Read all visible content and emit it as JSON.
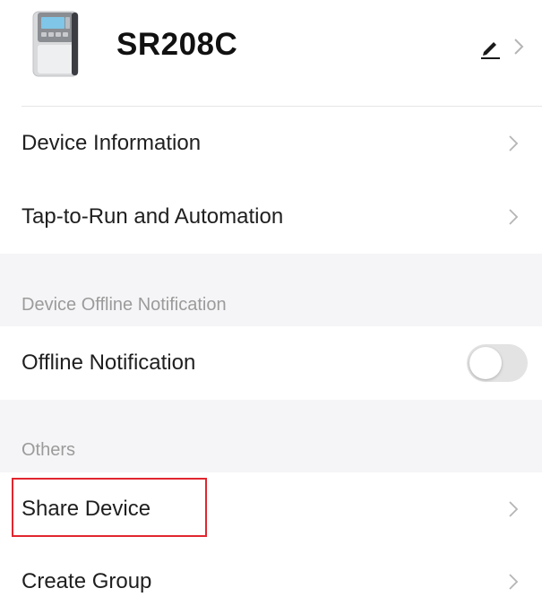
{
  "header": {
    "device_name": "SR208C",
    "device_image": "controller-device-image",
    "edit_icon": "pencil-icon",
    "chevron_icon": "chevron-right-icon"
  },
  "rows": {
    "device_information": "Device Information",
    "tap_to_run": "Tap-to-Run and Automation",
    "offline_notification": "Offline Notification",
    "share_device": "Share Device",
    "create_group": "Create Group"
  },
  "sections": {
    "offline_title": "Device Offline Notification",
    "others_title": "Others"
  },
  "toggles": {
    "offline_notification_on": false
  },
  "colors": {
    "section_bg": "#f5f5f7",
    "toggle_off": "#e3e3e3",
    "highlight": "#e0262f",
    "chevron": "#b5b5b5"
  }
}
